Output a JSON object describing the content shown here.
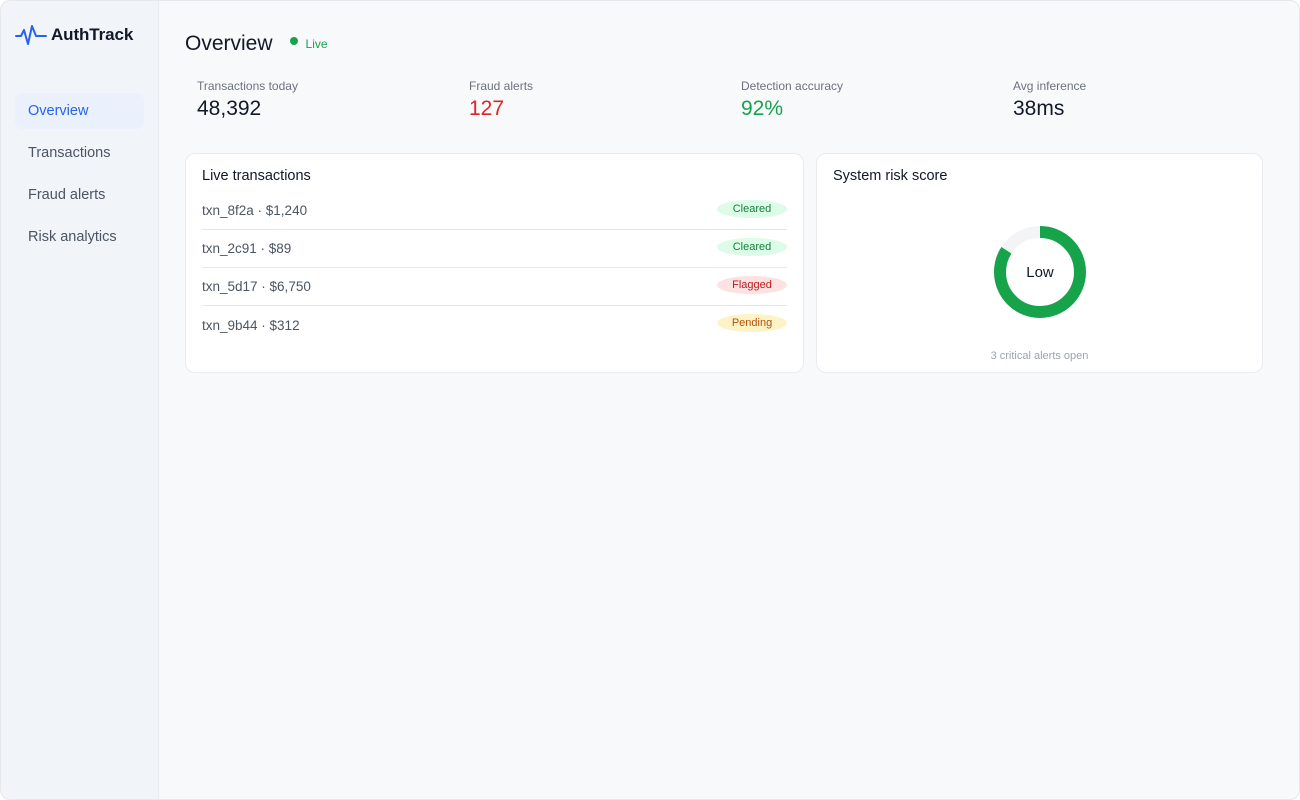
{
  "brand": {
    "name": "AuthTrack",
    "icon": "pulse-icon",
    "accent": "#2563eb"
  },
  "sidebar": {
    "items": [
      {
        "label": "Overview",
        "active": true
      },
      {
        "label": "Transactions",
        "active": false
      },
      {
        "label": "Fraud alerts",
        "active": false
      },
      {
        "label": "Risk analytics",
        "active": false
      }
    ]
  },
  "header": {
    "title": "Overview",
    "status": "Live",
    "status_color": "#16a34a"
  },
  "stats": [
    {
      "label": "Transactions today",
      "value": "48,392",
      "color": "#111827"
    },
    {
      "label": "Fraud alerts",
      "value": "127",
      "color": "#dc2626"
    },
    {
      "label": "Detection accuracy",
      "value": "92%",
      "color": "#16a34a"
    },
    {
      "label": "Avg inference",
      "value": "38ms",
      "color": "#111827"
    }
  ],
  "live_transactions": {
    "title": "Live transactions",
    "rows": [
      {
        "text": "txn_8f2a · $1,240",
        "status": "Cleared"
      },
      {
        "text": "txn_2c91 · $89",
        "status": "Cleared"
      },
      {
        "text": "txn_5d17 · $6,750",
        "status": "Flagged"
      },
      {
        "text": "txn_9b44 · $312",
        "status": "Pending"
      }
    ]
  },
  "risk": {
    "title": "System risk score",
    "level": "Low",
    "gauge_fraction": 1.0,
    "gauge_color": "#16a34a",
    "note": "3 critical alerts open"
  }
}
